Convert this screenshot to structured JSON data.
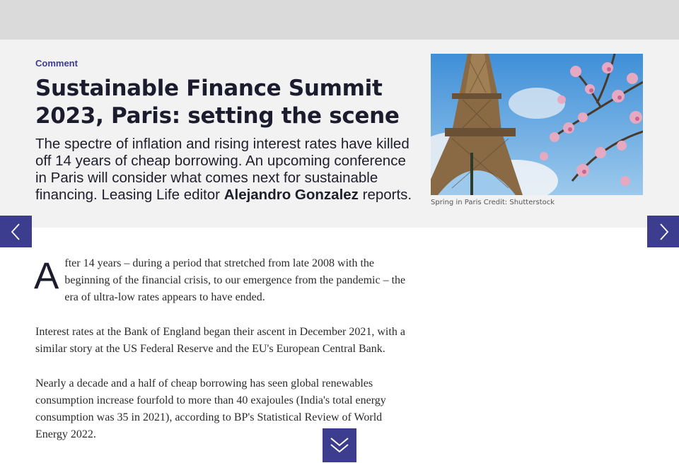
{
  "article": {
    "category": "Comment",
    "headline": "Sustainable Finance Summit 2023, Paris: setting the scene",
    "standfirst_text": "The spectre of inflation and rising interest rates have killed off 14 years of cheap borrowing. An upcoming conference in Paris will consider what comes next for sustainable financing. Leasing Life editor ",
    "author": "Alejandro Gonzalez",
    "standfirst_end": " reports.",
    "image_caption": "Spring in Paris Credit: Shutterstock",
    "dropcap": "A",
    "para1_rest": "fter 14 years – during a period that stretched from late 2008 with the beginning of the financial crisis, to our emergence from the pandemic – the era of ultra-low rates appears to have ended.",
    "para2": "Interest rates at the Bank of England began their ascent in December 2021, with a similar story at the US Federal Reserve and the EU's European Central Bank.",
    "para3": "Nearly a decade and a half of cheap borrowing has seen global renewables consumption increase fourfold to more than 40 exajoules (India's total energy consumption was 35 in 2021), according to BP's Statistical Review of World Energy 2022."
  },
  "icons": {
    "prev": "chevron-left-icon",
    "next": "chevron-right-icon",
    "scroll": "double-chevron-down-icon"
  },
  "colors": {
    "accent": "#3d3d8f",
    "top_bar": "#dadada",
    "hero_bg": "#f2f2f2"
  }
}
